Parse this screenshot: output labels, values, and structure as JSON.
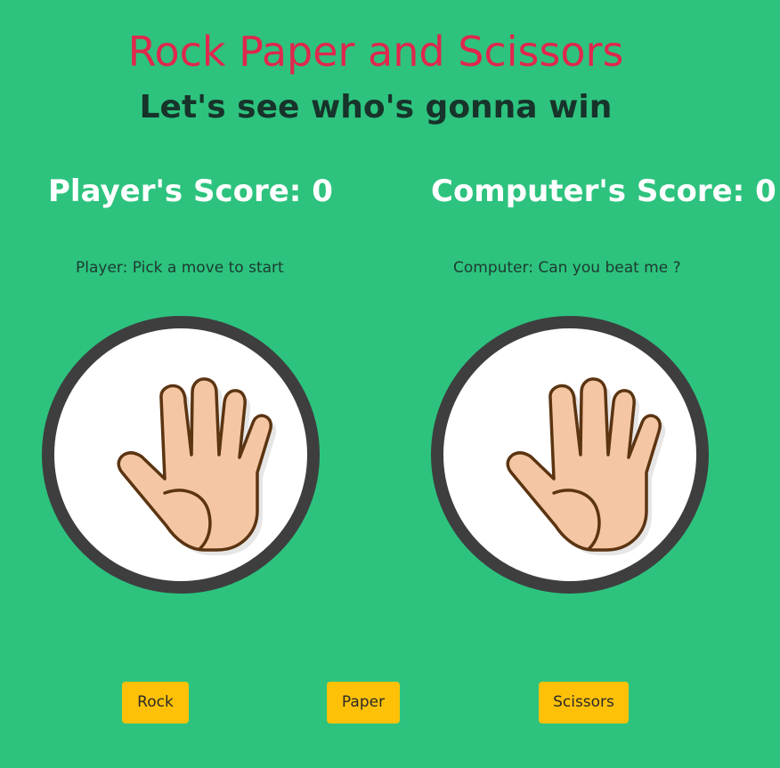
{
  "header": {
    "title": "Rock Paper and Scissors",
    "subtitle": "Let's see who's gonna win"
  },
  "player": {
    "score_text": "Player's Score: 0",
    "score": 0,
    "status": "Player: Pick a move to start",
    "hand_icon": "paper-hand-icon"
  },
  "computer": {
    "score_text": "Computer's Score: 0",
    "score": 0,
    "status": "Computer: Can you beat me ?",
    "hand_icon": "paper-hand-icon"
  },
  "controls": {
    "rock_label": "Rock",
    "paper_label": "Paper",
    "scissors_label": "Scissors"
  },
  "colors": {
    "background": "#2dc37e",
    "title": "#e0274d",
    "button": "#ffc107",
    "circle_border": "#3e3e3f",
    "skin": "#f4c6a3",
    "outline": "#5b3412"
  }
}
